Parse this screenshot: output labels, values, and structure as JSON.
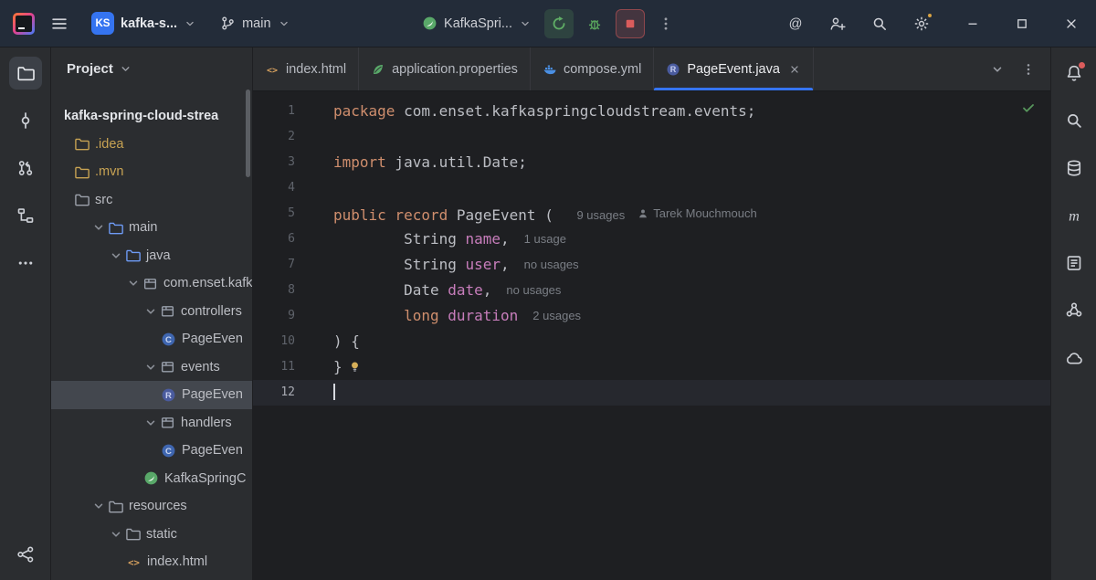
{
  "title_bar": {
    "project_widget": {
      "badge": "KS",
      "label": "kafka-s..."
    },
    "branch_widget": {
      "label": "main"
    },
    "run_widget": {
      "label": "KafkaSpri..."
    }
  },
  "left_strip": {
    "top": [
      {
        "name": "project",
        "icon": "folder",
        "active": true
      },
      {
        "name": "commit",
        "icon": "commit"
      },
      {
        "name": "pull-requests",
        "icon": "pull-request"
      },
      {
        "name": "structure",
        "icon": "structure"
      },
      {
        "name": "more-tool-windows",
        "icon": "more-h"
      }
    ],
    "bottom": [
      {
        "name": "version-control",
        "icon": "graph"
      }
    ]
  },
  "right_strip": [
    {
      "name": "notifications",
      "icon": "bell",
      "badge": true
    },
    {
      "name": "find",
      "icon": "magnifier"
    },
    {
      "name": "database",
      "icon": "database"
    },
    {
      "name": "maven",
      "icon": "maven"
    },
    {
      "name": "endpoints",
      "icon": "doc-list"
    },
    {
      "name": "beans",
      "icon": "beans"
    },
    {
      "name": "cloud",
      "icon": "cloud"
    }
  ],
  "project_panel": {
    "title": "Project",
    "tree": [
      {
        "label": "kafka-spring-cloud-strea",
        "depth": 0,
        "root": true
      },
      {
        "label": ".idea",
        "depth": 1,
        "icon": "folder-gold",
        "muted": true
      },
      {
        "label": ".mvn",
        "depth": 1,
        "icon": "folder-gold",
        "muted": true
      },
      {
        "label": "src",
        "depth": 1,
        "icon": "folder"
      },
      {
        "label": "main",
        "depth": 2,
        "icon": "folder-blue",
        "chevron": true
      },
      {
        "label": "java",
        "depth": 3,
        "icon": "folder-blue",
        "chevron": true
      },
      {
        "label": "com.enset.kafka",
        "depth": 4,
        "icon": "package",
        "chevron": true
      },
      {
        "label": "controllers",
        "depth": 5,
        "icon": "package",
        "chevron": true
      },
      {
        "label": "PageEven",
        "depth": 6,
        "icon": "class"
      },
      {
        "label": "events",
        "depth": 5,
        "icon": "package",
        "chevron": true
      },
      {
        "label": "PageEven",
        "depth": 6,
        "icon": "record",
        "selected": true
      },
      {
        "label": "handlers",
        "depth": 5,
        "icon": "package",
        "chevron": true
      },
      {
        "label": "PageEven",
        "depth": 6,
        "icon": "class"
      },
      {
        "label": "KafkaSpringC",
        "depth": 5,
        "icon": "spring-boot"
      },
      {
        "label": "resources",
        "depth": 2,
        "icon": "folder",
        "chevron": true
      },
      {
        "label": "static",
        "depth": 3,
        "icon": "folder",
        "chevron": true
      },
      {
        "label": "index.html",
        "depth": 4,
        "icon": "html"
      }
    ]
  },
  "tab_bar": {
    "tabs": [
      {
        "label": "index.html",
        "icon": "html"
      },
      {
        "label": "application.properties",
        "icon": "spring-leaf"
      },
      {
        "label": "compose.yml",
        "icon": "docker"
      },
      {
        "label": "PageEvent.java",
        "icon": "record",
        "active": true,
        "close": true
      }
    ]
  },
  "editor": {
    "lines": [
      {
        "num": 1,
        "tokens": [
          {
            "t": "kw",
            "s": "package"
          },
          {
            "t": "pl",
            "s": " com.enset.kafkaspringcloudstream.events;"
          }
        ]
      },
      {
        "num": 2,
        "tokens": []
      },
      {
        "num": 3,
        "tokens": [
          {
            "t": "kw",
            "s": "import"
          },
          {
            "t": "pl",
            "s": " java.util.Date;"
          }
        ]
      },
      {
        "num": 4,
        "tokens": []
      },
      {
        "num": 5,
        "tokens": [
          {
            "t": "kw",
            "s": "public record"
          },
          {
            "t": "pl",
            "s": " PageEvent ( "
          }
        ],
        "inlays": [
          {
            "type": "usages",
            "text": "9 usages"
          },
          {
            "type": "author",
            "text": "Tarek Mouchmouch"
          }
        ]
      },
      {
        "num": 6,
        "tokens": [
          {
            "t": "pl",
            "s": "        String "
          },
          {
            "t": "fld",
            "s": "name"
          },
          {
            "t": "pl",
            "s": ","
          }
        ],
        "inlays": [
          {
            "type": "usages",
            "text": "1 usage"
          }
        ]
      },
      {
        "num": 7,
        "tokens": [
          {
            "t": "pl",
            "s": "        String "
          },
          {
            "t": "fld",
            "s": "user"
          },
          {
            "t": "pl",
            "s": ","
          }
        ],
        "inlays": [
          {
            "type": "usages",
            "text": "no usages"
          }
        ]
      },
      {
        "num": 8,
        "tokens": [
          {
            "t": "pl",
            "s": "        Date "
          },
          {
            "t": "fld",
            "s": "date"
          },
          {
            "t": "pl",
            "s": ","
          }
        ],
        "inlays": [
          {
            "type": "usages",
            "text": "no usages"
          }
        ]
      },
      {
        "num": 9,
        "tokens": [
          {
            "t": "pl",
            "s": "        "
          },
          {
            "t": "kw",
            "s": "long"
          },
          {
            "t": "pl",
            "s": " "
          },
          {
            "t": "fld",
            "s": "duration"
          }
        ],
        "inlays": [
          {
            "type": "usages",
            "text": "2 usages"
          }
        ]
      },
      {
        "num": 10,
        "tokens": [
          {
            "t": "pl",
            "s": ") {"
          }
        ]
      },
      {
        "num": 11,
        "tokens": [
          {
            "t": "pl",
            "s": "}"
          }
        ],
        "bulb": true
      },
      {
        "num": 12,
        "tokens": [],
        "caret": true
      }
    ]
  },
  "colors": {
    "accent_blue": "#3574F0",
    "keyword_orange": "#CF8E6D",
    "field_purple": "#C77DBB",
    "inlay_gray": "#7A7E85",
    "run_green": "#5FAD65",
    "stop_red": "#DB5C5C",
    "spring_green": "#59A869",
    "docker_blue": "#4A8FE3",
    "gold_folder": "#C8A353"
  }
}
